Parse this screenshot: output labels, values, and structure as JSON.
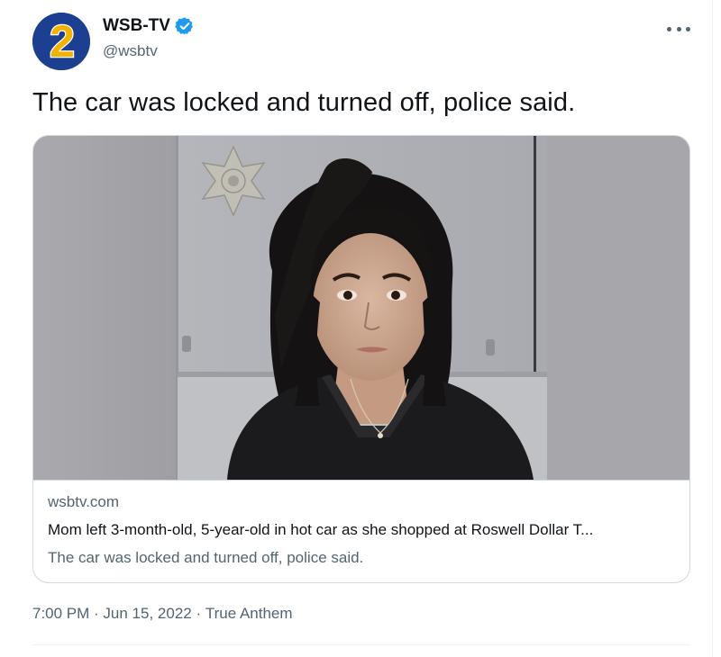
{
  "account": {
    "display_name": "WSB-TV",
    "handle": "@wsbtv",
    "avatar_icon": "channel-2-logo-icon",
    "avatar_number": "2",
    "verified_icon": "verified-badge-icon"
  },
  "tweet": {
    "text": "The car was locked and turned off, police said."
  },
  "card": {
    "image_icon": "mugshot-photo",
    "badge_icon": "sheriff-star-badge-icon",
    "domain": "wsbtv.com",
    "title": "Mom left 3-month-old, 5-year-old in hot car as she shopped at Roswell Dollar T...",
    "description": "The car was locked and turned off, police said."
  },
  "meta": {
    "time": "7:00 PM",
    "separator": " · ",
    "date": "Jun 15, 2022",
    "source": "True Anthem"
  },
  "colors": {
    "text_primary": "#0f1419",
    "text_secondary": "#536471",
    "verified_blue": "#1d9bf0",
    "border": "#cfd9de",
    "avatar_blue": "#1d3f91",
    "avatar_yellow": "#f2b300"
  },
  "more_icon": "more-options-icon"
}
